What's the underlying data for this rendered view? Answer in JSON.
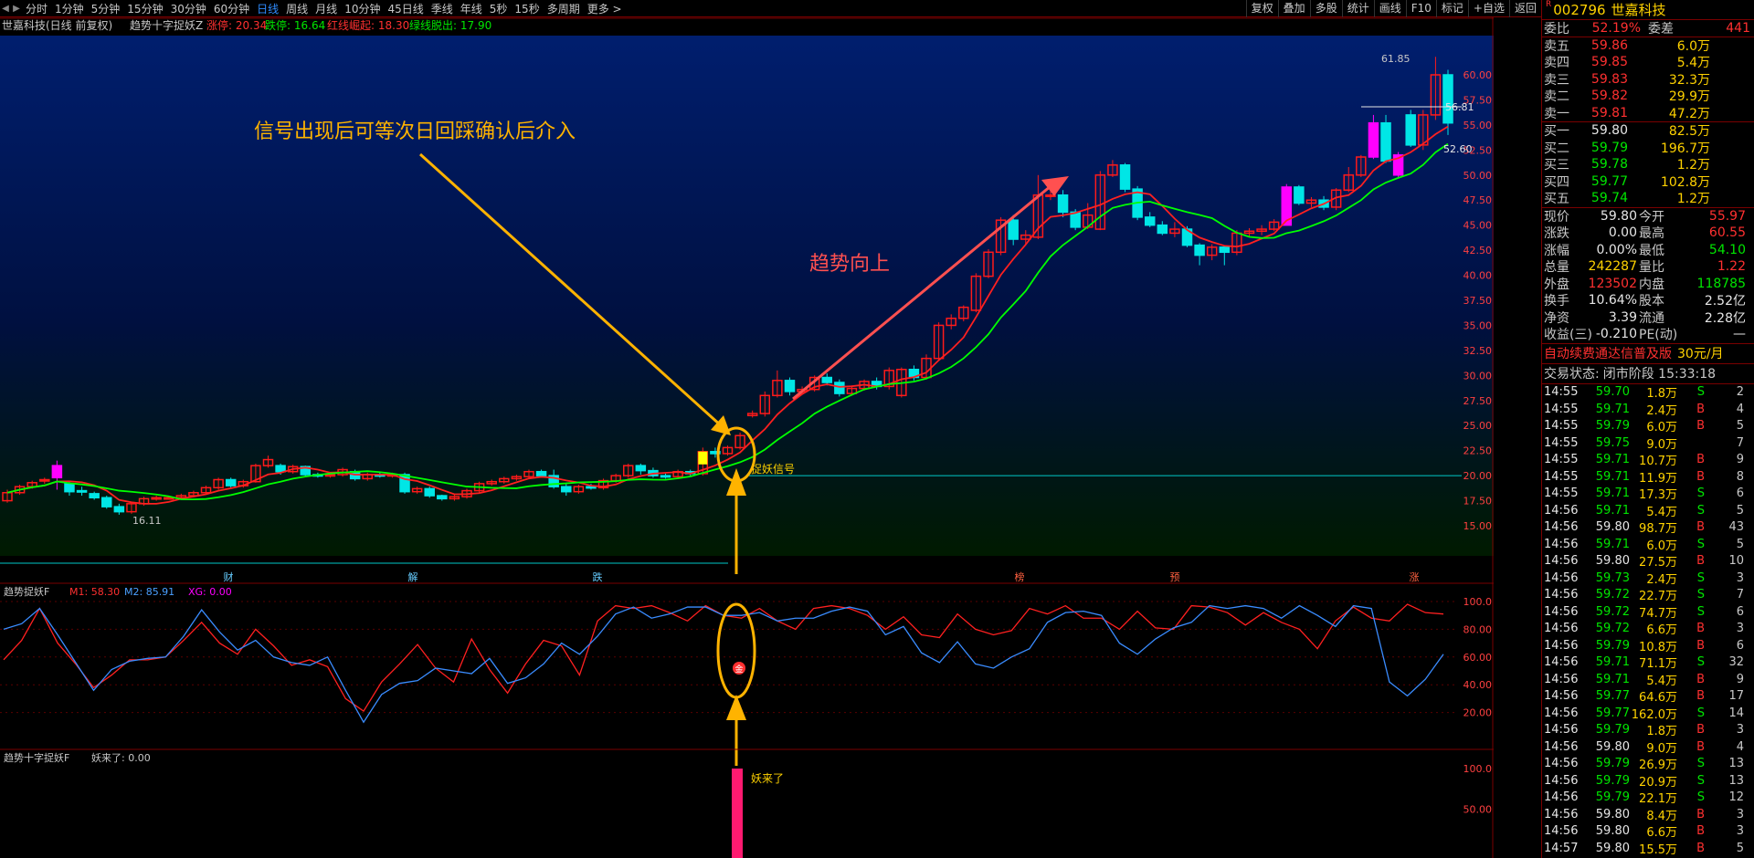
{
  "toolbar": {
    "items": [
      "分时",
      "1分钟",
      "5分钟",
      "15分钟",
      "30分钟",
      "60分钟",
      "日线",
      "周线",
      "月线",
      "10分钟",
      "45日线",
      "季线",
      "年线",
      "5秒",
      "15秒",
      "多周期",
      "更多 >"
    ],
    "active_index": 6,
    "right_items": [
      "复权",
      "叠加",
      "多股",
      "统计",
      "画线",
      "F10",
      "标记",
      "+自选",
      "返回"
    ]
  },
  "main": {
    "header": {
      "title": "世嘉科技(日线 前复权)",
      "indicator": "趋势十字捉妖Z",
      "limit_up_label": "涨停: 20.34",
      "limit_down_label": "跌停: 16.64",
      "red_label": "红线崛起: 18.30",
      "green_label": "绿线脱出: 17.90"
    },
    "annotation_text": "信号出现后可等次日回踩确认后介入",
    "trend_text": "趋势向上",
    "signal_text": "捉妖信号",
    "price_labels": {
      "high": "61.85",
      "mid": "56.81",
      "low52": "52.60",
      "low": "16.11"
    },
    "axis": [
      "60.00",
      "57.50",
      "55.00",
      "52.50",
      "50.00",
      "47.50",
      "45.00",
      "42.50",
      "40.00",
      "37.50",
      "35.00",
      "32.50",
      "30.00",
      "27.50",
      "25.00",
      "22.50",
      "20.00",
      "17.50",
      "15.00"
    ],
    "markers": [
      "财",
      "解",
      "跌",
      "榜",
      "预",
      "涨"
    ]
  },
  "ind1": {
    "title": "趋势捉妖F",
    "m1_label": "M1: 58.30",
    "m2_label": "M2: 85.91",
    "xg_label": "XG: 0.00",
    "axis": [
      "100.0",
      "80.00",
      "60.00",
      "40.00",
      "20.00"
    ],
    "badge": "金"
  },
  "ind2": {
    "title": "趋势十字捉妖F",
    "label": "妖来了: 0.00",
    "signal_text": "妖来了",
    "axis": [
      "100.0",
      "50.00"
    ]
  },
  "colors": {
    "up": "#ff1a1a",
    "down": "#00e6e6",
    "magenta": "#ff00ff",
    "ma_red": "#ff2020",
    "ma_green": "#00ff00",
    "annotation": "#ffb300",
    "trend_arrow": "#ff5050",
    "bg_top": "#001e6e",
    "bg_bottom": "#001a00"
  },
  "chart_data": [
    {
      "type": "candlestick",
      "series": [
        {
          "name": "K",
          "values": [
            [
              17.5,
              18.3,
              17.3,
              18.6
            ],
            [
              18.3,
              18.9,
              18.1,
              19.1
            ],
            [
              18.9,
              19.3,
              18.7,
              19.5
            ],
            [
              19.5,
              19.6,
              19.2,
              19.8
            ],
            [
              19.8,
              21.0,
              18.6,
              21.5
            ],
            [
              19.2,
              18.4,
              18.0,
              19.4
            ],
            [
              18.5,
              18.4,
              18.0,
              18.9
            ],
            [
              18.2,
              17.8,
              17.6,
              18.4
            ],
            [
              17.8,
              16.9,
              16.7,
              18.0
            ],
            [
              16.9,
              16.4,
              16.1,
              17.2
            ],
            [
              16.4,
              17.2,
              16.2,
              17.4
            ],
            [
              17.2,
              17.7,
              17.0,
              17.9
            ],
            [
              17.7,
              17.8,
              17.5,
              18.0
            ],
            [
              17.8,
              17.8,
              17.6,
              18.0
            ],
            [
              17.8,
              18.0,
              17.6,
              18.2
            ],
            [
              18.0,
              18.3,
              17.9,
              18.5
            ],
            [
              18.3,
              18.8,
              18.1,
              19.0
            ],
            [
              18.8,
              19.6,
              18.6,
              19.8
            ],
            [
              19.6,
              19.0,
              18.8,
              19.8
            ],
            [
              19.0,
              19.4,
              18.8,
              19.6
            ],
            [
              19.4,
              21.0,
              19.3,
              21.2
            ],
            [
              21.0,
              21.6,
              20.8,
              22.0
            ],
            [
              21.0,
              20.4,
              20.1,
              21.2
            ],
            [
              20.4,
              20.9,
              20.2,
              21.1
            ],
            [
              20.9,
              20.1,
              19.9,
              21.0
            ],
            [
              20.1,
              20.0,
              19.8,
              20.3
            ],
            [
              20.0,
              20.1,
              19.8,
              20.3
            ],
            [
              20.1,
              20.6,
              19.9,
              20.8
            ],
            [
              20.4,
              19.7,
              19.5,
              20.6
            ],
            [
              19.7,
              20.1,
              19.5,
              20.3
            ],
            [
              20.1,
              20.0,
              19.8,
              20.3
            ],
            [
              20.0,
              20.1,
              19.8,
              20.3
            ],
            [
              20.1,
              18.4,
              18.2,
              20.3
            ],
            [
              18.4,
              18.7,
              18.2,
              18.9
            ],
            [
              18.7,
              18.0,
              17.8,
              18.9
            ],
            [
              18.0,
              17.7,
              17.5,
              18.1
            ],
            [
              17.7,
              17.9,
              17.5,
              18.1
            ],
            [
              17.9,
              18.5,
              17.7,
              18.7
            ],
            [
              18.5,
              19.2,
              18.3,
              19.4
            ],
            [
              19.2,
              19.4,
              19.0,
              19.6
            ],
            [
              19.4,
              19.7,
              19.2,
              19.9
            ],
            [
              19.7,
              19.9,
              19.5,
              20.1
            ],
            [
              19.9,
              20.4,
              19.7,
              20.6
            ],
            [
              20.4,
              20.0,
              19.8,
              20.6
            ],
            [
              20.0,
              18.9,
              18.7,
              20.6
            ],
            [
              18.9,
              18.4,
              18.0,
              19.3
            ],
            [
              18.4,
              18.9,
              18.2,
              19.1
            ],
            [
              18.9,
              18.8,
              18.6,
              19.2
            ],
            [
              18.8,
              19.5,
              18.6,
              19.7
            ],
            [
              19.5,
              20.0,
              19.3,
              20.2
            ],
            [
              20.0,
              21.0,
              19.8,
              21.2
            ],
            [
              21.0,
              20.5,
              20.1,
              21.2
            ],
            [
              20.5,
              20.0,
              19.8,
              20.8
            ],
            [
              20.0,
              19.9,
              19.7,
              20.2
            ],
            [
              19.9,
              20.4,
              19.7,
              20.6
            ],
            [
              20.4,
              20.2,
              20.0,
              20.6
            ],
            [
              20.2,
              22.4,
              20.0,
              22.8
            ],
            [
              22.4,
              22.2,
              21.8,
              22.8
            ],
            [
              22.2,
              22.8,
              22.0,
              23.0
            ],
            [
              22.8,
              24.0,
              22.6,
              24.3
            ],
            [
              26.0,
              26.2,
              25.8,
              26.5
            ],
            [
              26.2,
              28.0,
              25.9,
              28.4
            ],
            [
              28.0,
              29.5,
              27.8,
              30.5
            ],
            [
              29.5,
              28.4,
              28.0,
              29.8
            ],
            [
              28.4,
              28.6,
              28.2,
              28.9
            ],
            [
              28.6,
              29.8,
              28.4,
              30.0
            ],
            [
              29.8,
              29.3,
              29.0,
              30.2
            ],
            [
              29.3,
              28.2,
              27.9,
              29.6
            ],
            [
              28.2,
              28.7,
              28.0,
              29.0
            ],
            [
              28.7,
              29.4,
              28.5,
              29.6
            ],
            [
              29.4,
              28.9,
              28.6,
              29.8
            ],
            [
              28.9,
              30.5,
              28.6,
              30.8
            ],
            [
              28.0,
              30.6,
              27.8,
              30.8
            ],
            [
              30.6,
              29.8,
              29.5,
              31.0
            ],
            [
              29.8,
              31.7,
              29.6,
              32.1
            ],
            [
              31.7,
              35.0,
              31.5,
              35.3
            ],
            [
              35.0,
              35.7,
              34.6,
              36.1
            ],
            [
              35.7,
              36.8,
              35.4,
              37.0
            ],
            [
              36.5,
              39.9,
              36.3,
              40.2
            ],
            [
              39.9,
              42.3,
              39.7,
              42.6
            ],
            [
              42.3,
              45.5,
              42.0,
              45.8
            ],
            [
              45.5,
              43.6,
              43.0,
              46.0
            ],
            [
              43.6,
              44.0,
              43.0,
              44.5
            ],
            [
              43.8,
              48.0,
              43.6,
              50.0
            ],
            [
              48.0,
              48.0,
              47.5,
              48.9
            ],
            [
              48.0,
              46.3,
              45.8,
              48.5
            ],
            [
              46.3,
              44.8,
              44.5,
              46.6
            ],
            [
              44.8,
              46.0,
              44.6,
              47.2
            ],
            [
              44.6,
              50.0,
              44.5,
              50.4
            ],
            [
              50.0,
              51.0,
              49.8,
              51.5
            ],
            [
              51.0,
              48.6,
              48.3,
              51.2
            ],
            [
              48.6,
              45.8,
              45.5,
              48.9
            ],
            [
              45.8,
              45.0,
              44.8,
              46.3
            ],
            [
              45.0,
              44.2,
              44.0,
              45.4
            ],
            [
              44.2,
              44.6,
              43.8,
              45.3
            ],
            [
              44.6,
              43.0,
              42.8,
              44.9
            ],
            [
              43.0,
              42.0,
              41.0,
              43.2
            ],
            [
              42.0,
              42.8,
              41.5,
              43.1
            ],
            [
              42.8,
              42.3,
              41.0,
              43.0
            ],
            [
              42.3,
              44.2,
              42.0,
              44.5
            ],
            [
              44.2,
              44.4,
              43.8,
              44.7
            ],
            [
              44.4,
              44.6,
              44.0,
              45.0
            ],
            [
              44.6,
              45.3,
              44.4,
              45.6
            ],
            [
              45.0,
              48.8,
              45.0,
              49.1
            ],
            [
              48.8,
              47.2,
              47.0,
              49.0
            ],
            [
              47.2,
              47.5,
              46.8,
              47.8
            ],
            [
              47.5,
              46.8,
              46.5,
              47.9
            ],
            [
              46.8,
              48.5,
              46.5,
              48.7
            ],
            [
              48.5,
              50.0,
              48.3,
              50.8
            ],
            [
              50.0,
              51.8,
              49.8,
              52.0
            ],
            [
              51.8,
              55.2,
              51.6,
              56.0
            ],
            [
              55.2,
              51.4,
              51.2,
              56.0
            ],
            [
              52.0,
              50.0,
              49.8,
              52.3
            ],
            [
              56.0,
              53.0,
              52.8,
              56.5
            ],
            [
              53.0,
              56.0,
              52.5,
              56.5
            ],
            [
              56.0,
              60.0,
              55.5,
              61.8
            ],
            [
              60.0,
              55.2,
              54.0,
              60.5
            ]
          ]
        }
      ]
    },
    {
      "type": "line",
      "series": [
        {
          "name": "M1",
          "values": [
            58,
            72,
            95,
            70,
            55,
            38,
            47,
            58,
            58,
            60,
            72,
            85,
            70,
            62,
            80,
            68,
            54,
            58,
            53,
            30,
            21,
            42,
            55,
            69,
            52,
            42,
            73,
            51,
            34,
            55,
            72,
            68,
            47,
            86,
            97,
            95,
            97,
            92,
            86,
            97,
            90,
            88,
            95,
            86,
            80,
            95,
            97,
            95,
            90,
            80,
            89,
            76,
            74,
            91,
            80,
            76,
            79,
            95,
            91,
            97,
            88,
            88,
            80,
            93,
            81,
            80,
            97,
            96,
            92,
            83,
            92,
            85,
            80,
            66,
            86,
            96,
            88,
            86,
            98,
            92,
            91
          ]
        },
        {
          "name": "M2",
          "values": [
            80,
            84,
            95,
            76,
            56,
            36,
            51,
            57,
            59,
            60,
            75,
            94,
            78,
            65,
            72,
            60,
            56,
            54,
            60,
            36,
            13,
            33,
            41,
            43,
            52,
            50,
            48,
            59,
            41,
            45,
            55,
            70,
            62,
            75,
            91,
            96,
            88,
            91,
            96,
            96,
            90,
            90,
            92,
            86,
            88,
            88,
            93,
            96,
            93,
            76,
            82,
            63,
            56,
            71,
            55,
            52,
            60,
            66,
            85,
            92,
            93,
            90,
            70,
            62,
            73,
            81,
            85,
            97,
            95,
            97,
            95,
            88,
            97,
            90,
            82,
            97,
            95,
            42,
            32,
            44,
            62
          ]
        }
      ]
    },
    {
      "type": "bar",
      "series": [
        {
          "name": "妖来了",
          "values": [
            100
          ]
        }
      ]
    }
  ]
}
